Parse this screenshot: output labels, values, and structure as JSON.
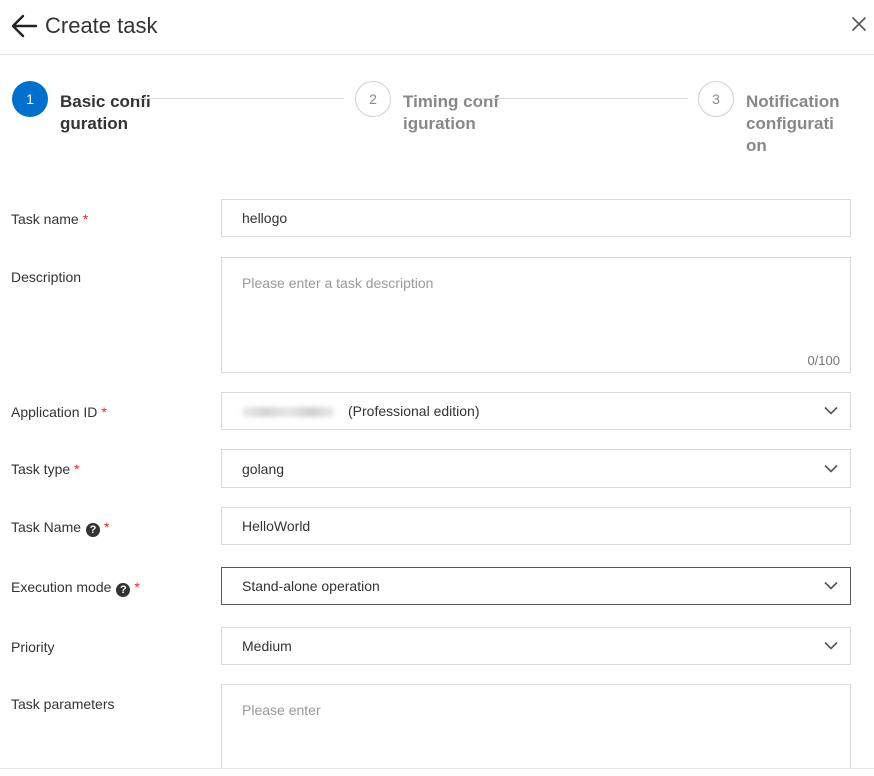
{
  "header": {
    "title": "Create task"
  },
  "steps": [
    {
      "number": "1",
      "label": "Basic configuration",
      "state": "active"
    },
    {
      "number": "2",
      "label": "Timing configuration",
      "state": "inactive"
    },
    {
      "number": "3",
      "label": "Notification configuration",
      "state": "inactive"
    }
  ],
  "form": {
    "task_name": {
      "label": "Task name",
      "required": "*",
      "value": "hellogo"
    },
    "description": {
      "label": "Description",
      "placeholder": "Please enter a task description",
      "counter": "0/100"
    },
    "application_id": {
      "label": "Application ID",
      "required": "*",
      "value_suffix": "(Professional edition)"
    },
    "task_type": {
      "label": "Task type",
      "required": "*",
      "value": "golang"
    },
    "task_name_2": {
      "label": "Task Name",
      "required": "*",
      "value": "HelloWorld"
    },
    "execution_mode": {
      "label": "Execution mode",
      "required": "*",
      "value": "Stand-alone operation"
    },
    "priority": {
      "label": "Priority",
      "value": "Medium"
    },
    "task_parameters": {
      "label": "Task parameters",
      "placeholder": "Please enter"
    }
  },
  "colors": {
    "primary": "#0070cc",
    "required": "#d93026",
    "border": "#d9d9d9"
  },
  "icons": {
    "back": "arrow-left-icon",
    "close": "close-icon",
    "dropdown": "chevron-down-icon",
    "help": "question-circle-icon"
  }
}
